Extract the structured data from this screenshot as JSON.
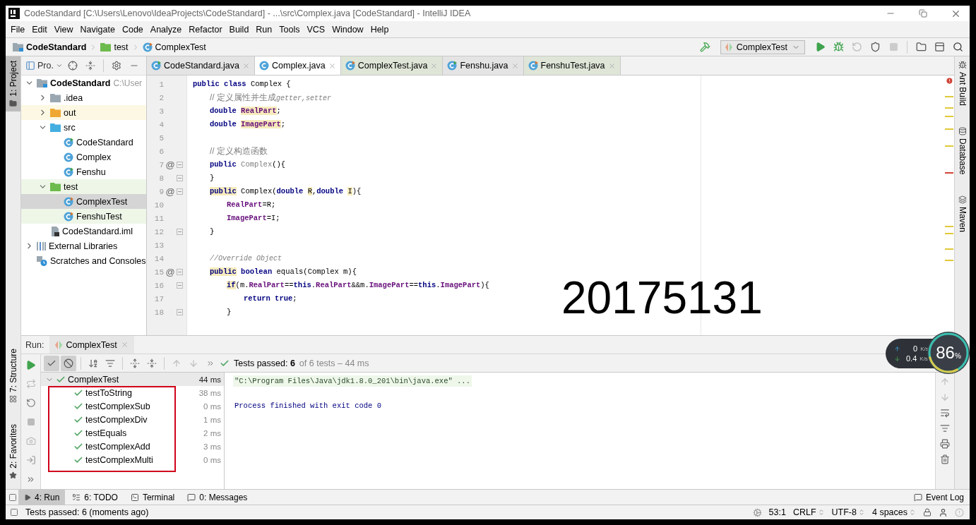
{
  "window": {
    "title": "CodeStandard [C:\\Users\\Lenovo\\IdeaProjects\\CodeStandard] - ...\\src\\Complex.java [CodeStandard] - IntelliJ IDEA"
  },
  "menu": [
    "File",
    "Edit",
    "View",
    "Navigate",
    "Code",
    "Analyze",
    "Refactor",
    "Build",
    "Run",
    "Tools",
    "VCS",
    "Window",
    "Help"
  ],
  "breadcrumbs": [
    {
      "label": "CodeStandard",
      "kind": "project"
    },
    {
      "label": "test",
      "kind": "test-folder"
    },
    {
      "label": "ComplexTest",
      "kind": "test-class"
    }
  ],
  "run_config": {
    "label": "ComplexTest"
  },
  "left_tool_windows": [
    {
      "label": "1: Project",
      "selected": true,
      "kind": "folder"
    },
    {
      "label": "7: Structure",
      "selected": false,
      "kind": "structure"
    },
    {
      "label": "2: Favorites",
      "selected": false,
      "kind": "star"
    }
  ],
  "right_tool_windows": [
    {
      "label": "Ant Build",
      "kind": "ant"
    },
    {
      "label": "Database",
      "kind": "database"
    },
    {
      "label": "Maven",
      "kind": "maven"
    }
  ],
  "project_panel": {
    "title": "Pro.",
    "tree": [
      {
        "label": "CodeStandard",
        "hint": "C:\\User",
        "kind": "module",
        "expanded": true,
        "selected": false,
        "children": [
          {
            "label": ".idea",
            "kind": "folder",
            "expanded": false,
            "selected": false
          },
          {
            "label": "out",
            "kind": "excluded-folder",
            "expanded": false,
            "selected": false
          },
          {
            "label": "src",
            "kind": "source-folder",
            "expanded": true,
            "selected": false,
            "children": [
              {
                "label": "CodeStandard",
                "kind": "runnable-class",
                "selected": false
              },
              {
                "label": "Complex",
                "kind": "class",
                "selected": false
              },
              {
                "label": "Fenshu",
                "kind": "runnable-class",
                "selected": false
              }
            ]
          },
          {
            "label": "test",
            "kind": "test-folder",
            "expanded": true,
            "selected": false,
            "children": [
              {
                "label": "ComplexTest",
                "kind": "test-class",
                "selected": true
              },
              {
                "label": "FenshuTest",
                "kind": "test-class",
                "selected": false
              }
            ]
          },
          {
            "label": "CodeStandard.iml",
            "kind": "iml-file",
            "selected": false
          }
        ]
      },
      {
        "label": "External Libraries",
        "kind": "libraries",
        "expanded": false,
        "selected": false
      },
      {
        "label": "Scratches and Consoles",
        "kind": "scratches",
        "selected": false
      }
    ]
  },
  "editor_tabs": [
    {
      "label": "CodeStandard.java",
      "kind": "runnable-class",
      "selected": false
    },
    {
      "label": "Complex.java",
      "kind": "class",
      "selected": true
    },
    {
      "label": "ComplexTest.java",
      "kind": "test-class",
      "selected": false
    },
    {
      "label": "Fenshu.java",
      "kind": "runnable-class",
      "selected": false
    },
    {
      "label": "FenshuTest.java",
      "kind": "test-class",
      "selected": false
    }
  ],
  "code_lines": [
    {
      "number": "1",
      "tokens": [
        {
          "kind": "keyword",
          "text": "public class "
        },
        {
          "kind": "plain",
          "text": "Complex {"
        }
      ]
    },
    {
      "number": "2",
      "kind": "class",
      "tokens": [
        {
          "kind": "comment",
          "text": "// 定义属性并生成"
        },
        {
          "kind": "italic-comment",
          "text": "getter,setter"
        }
      ]
    },
    {
      "number": "3",
      "kind": "class",
      "tokens": [
        {
          "kind": "keyword",
          "text": "double "
        },
        {
          "kind": "highlighted-field",
          "text": "RealPart"
        },
        {
          "kind": "plain",
          "text": ";"
        }
      ]
    },
    {
      "number": "4",
      "kind": "class",
      "tokens": [
        {
          "kind": "keyword",
          "text": "double "
        },
        {
          "kind": "highlighted-field",
          "text": "ImagePart"
        },
        {
          "kind": "plain",
          "text": ";"
        }
      ]
    },
    {
      "number": "5"
    },
    {
      "number": "6",
      "kind": "class",
      "tokens": [
        {
          "kind": "comment",
          "text": "// 定义构造函数"
        }
      ]
    },
    {
      "number": "7",
      "marker": "@",
      "fold": true,
      "kind": "class",
      "tokens": [
        {
          "kind": "keyword",
          "text": "public "
        },
        {
          "kind": "unused",
          "text": "Complex"
        },
        {
          "kind": "plain",
          "text": "(){"
        }
      ]
    },
    {
      "number": "8",
      "fold": true,
      "kind": "class",
      "tokens": [
        {
          "kind": "plain",
          "text": "}"
        }
      ]
    },
    {
      "number": "9",
      "marker": "@",
      "fold": true,
      "kind": "class",
      "tokens": [
        {
          "kind": "highlighted-keyword",
          "text": "public"
        },
        {
          "kind": "plain",
          "text": " Complex("
        },
        {
          "kind": "keyword",
          "text": "double "
        },
        {
          "kind": "highlighted-plain",
          "text": "R"
        },
        {
          "kind": "plain",
          "text": ","
        },
        {
          "kind": "keyword",
          "text": "double "
        },
        {
          "kind": "highlighted-plain",
          "text": "I"
        },
        {
          "kind": "plain",
          "text": "){"
        }
      ]
    },
    {
      "number": "10",
      "kind": "method",
      "tokens": [
        {
          "kind": "field",
          "text": "RealPart"
        },
        {
          "kind": "plain",
          "text": "=R;"
        }
      ]
    },
    {
      "number": "11",
      "kind": "method",
      "tokens": [
        {
          "kind": "field",
          "text": "ImagePart"
        },
        {
          "kind": "plain",
          "text": "=I;"
        }
      ]
    },
    {
      "number": "12",
      "fold": true,
      "kind": "class",
      "tokens": [
        {
          "kind": "plain",
          "text": "}"
        }
      ]
    },
    {
      "number": "13"
    },
    {
      "number": "14",
      "kind": "class",
      "tokens": [
        {
          "kind": "italic-comment",
          "text": "//Override Object"
        }
      ]
    },
    {
      "number": "15",
      "marker": "@",
      "fold": true,
      "kind": "class",
      "tokens": [
        {
          "kind": "highlighted-keyword",
          "text": "public"
        },
        {
          "kind": "keyword",
          "text": " boolean "
        },
        {
          "kind": "plain",
          "text": "equals(Complex m){"
        }
      ]
    },
    {
      "number": "16",
      "fold": true,
      "kind": "method",
      "tokens": [
        {
          "kind": "highlighted-keyword",
          "text": "if"
        },
        {
          "kind": "plain",
          "text": "(m."
        },
        {
          "kind": "field",
          "text": "RealPart"
        },
        {
          "kind": "plain",
          "text": "=="
        },
        {
          "kind": "keyword",
          "text": "this"
        },
        {
          "kind": "plain",
          "text": "."
        },
        {
          "kind": "field",
          "text": "RealPart"
        },
        {
          "kind": "plain",
          "text": "&&m."
        },
        {
          "kind": "field",
          "text": "ImagePart"
        },
        {
          "kind": "plain",
          "text": "=="
        },
        {
          "kind": "keyword",
          "text": "this"
        },
        {
          "kind": "plain",
          "text": "."
        },
        {
          "kind": "field",
          "text": "ImagePart"
        },
        {
          "kind": "plain",
          "text": "){"
        }
      ]
    },
    {
      "number": "17",
      "kind": "block",
      "tokens": [
        {
          "kind": "keyword",
          "text": "return true"
        },
        {
          "kind": "plain",
          "text": ";"
        }
      ]
    },
    {
      "number": "18",
      "fold": true,
      "kind": "method",
      "tokens": [
        {
          "kind": "plain",
          "text": "}"
        }
      ]
    }
  ],
  "overlay_text": "20175131",
  "run_panel": {
    "label": "Run:",
    "tab": "ComplexTest",
    "filters": [
      {
        "kind": "passed",
        "on": true
      },
      {
        "kind": "ignored",
        "on": true
      }
    ],
    "summary": "Tests passed: **6**",
    "summary_detail": "of 6 tests – 44 ms",
    "tests": [
      {
        "name": "ComplexTest",
        "time": "44 ms",
        "passed": true,
        "expanded": true,
        "highlighted": true,
        "children": [
          {
            "name": "testToString",
            "time": "38 ms",
            "passed": true
          },
          {
            "name": "testComplexSub",
            "time": "0 ms",
            "passed": true
          },
          {
            "name": "testComplexDiv",
            "time": "1 ms",
            "passed": true
          },
          {
            "name": "testEquals",
            "time": "2 ms",
            "passed": true
          },
          {
            "name": "testComplexAdd",
            "time": "3 ms",
            "passed": true
          },
          {
            "name": "testComplexMulti",
            "time": "0 ms",
            "passed": true
          }
        ]
      }
    ],
    "console": [
      {
        "kind": "command",
        "text": "\"C:\\Program Files\\Java\\jdk1.8.0_201\\bin\\java.exe\" ..."
      },
      {
        "kind": "output",
        "text": "Process finished with exit code 0"
      }
    ]
  },
  "network_widget": {
    "upload": "0",
    "upload_unit": "K/s",
    "download": "0.4",
    "download_unit": "K/s",
    "value": "86",
    "unit": "%"
  },
  "bottom_tools": [
    {
      "label": "4: Run",
      "kind": "run",
      "selected": true
    },
    {
      "label": "6: TODO",
      "kind": "todo",
      "selected": false
    },
    {
      "label": "Terminal",
      "kind": "terminal",
      "selected": false
    },
    {
      "label": "0: Messages",
      "kind": "messages",
      "selected": false
    }
  ],
  "event_log": "Event Log",
  "status_bar": {
    "message": "Tests passed: 6 (moments ago)",
    "position": "53:1",
    "line_separator": "CRLF",
    "encoding": "UTF-8",
    "indent": "4 spaces"
  }
}
